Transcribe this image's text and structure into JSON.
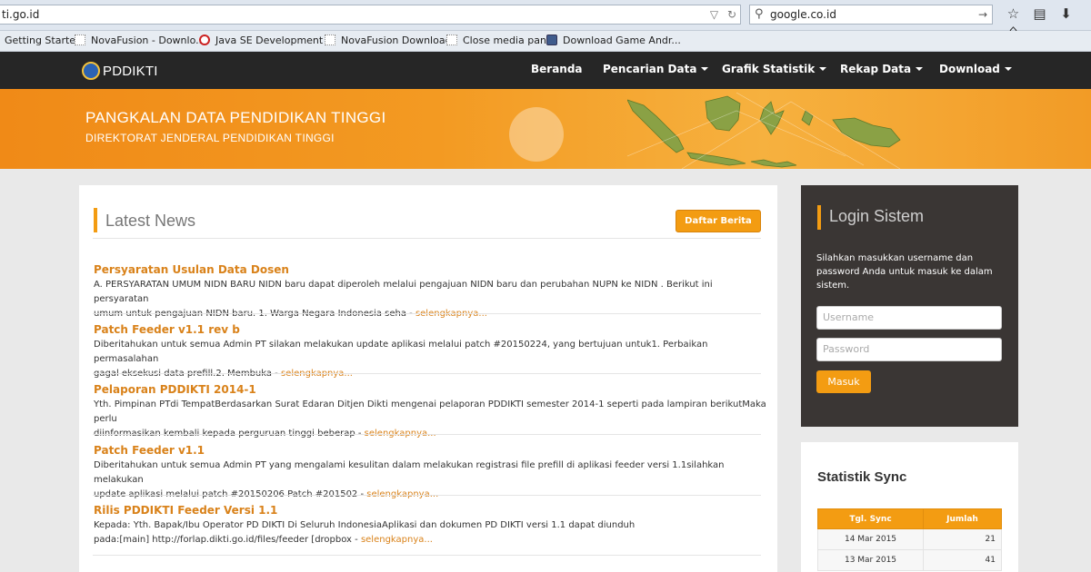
{
  "browser": {
    "url": "ti.go.id",
    "search_value": "google.co.id",
    "bookmarks": [
      {
        "label": "Getting Started"
      },
      {
        "label": "NovaFusion - Downlo..."
      },
      {
        "label": "Java SE Development ..."
      },
      {
        "label": "NovaFusion Downloads"
      },
      {
        "label": "Close media panel"
      },
      {
        "label": "Download Game Andr..."
      }
    ]
  },
  "site": {
    "logo": "PDDIKTI",
    "nav": [
      {
        "label": "Beranda",
        "dropdown": false
      },
      {
        "label": "Pencarian Data",
        "dropdown": true
      },
      {
        "label": "Grafik Statistik",
        "dropdown": true
      },
      {
        "label": "Rekap Data",
        "dropdown": true
      },
      {
        "label": "Download",
        "dropdown": true
      }
    ],
    "banner": {
      "title": "PANGKALAN DATA PENDIDIKAN TINGGI",
      "subtitle": "DIREKTORAT JENDERAL PENDIDIKAN TINGGI"
    }
  },
  "news": {
    "title": "Latest News",
    "daftar_label": "Daftar Berita",
    "read_more": "selengkapnya...",
    "items": [
      {
        "title": "Persyaratan Usulan Data Dosen",
        "line1": "A. PERSYARATAN UMUM NIDN BARU NIDN baru dapat diperoleh melalui pengajuan NIDN baru dan perubahan NUPN ke NIDN . Berikut ini persyaratan",
        "line2": "umum untuk pengajuan NIDN baru. 1. Warga Negara Indonesia seha - "
      },
      {
        "title": "Patch Feeder v1.1 rev b",
        "line1": "Diberitahukan untuk semua Admin PT  silakan melakukan update aplikasi melalui patch #20150224, yang bertujuan untuk1. Perbaikan permasalahan",
        "line2": "gagal eksekusi data prefill.2. Membuka - "
      },
      {
        "title": "Pelaporan PDDIKTI 2014-1",
        "line1": "Yth. Pimpinan PTdi TempatBerdasarkan Surat Edaran Ditjen Dikti mengenai pelaporan PDDIKTI semester 2014-1 seperti pada lampiran berikutMaka perlu",
        "line2": "diinformasikan kembali kepada perguruan tinggi beberap - "
      },
      {
        "title": "Patch Feeder v1.1",
        "line1": "Diberitahukan untuk semua Admin PT yang mengalami kesulitan dalam melakukan registrasi file prefill di aplikasi feeder versi 1.1silahkan melakukan",
        "line2": "update aplikasi melalui patch #20150206 Patch #201502 - "
      },
      {
        "title": "Rilis PDDIKTI Feeder Versi 1.1",
        "line1": "Kepada: Yth. Bapak/Ibu Operator PD DIKTI Di Seluruh IndonesiaAplikasi dan dokumen PD DIKTI  versi 1.1 dapat diunduh",
        "line2": "pada:[main] http://forlap.dikti.go.id/files/feeder [dropbox - "
      }
    ]
  },
  "login": {
    "title": "Login Sistem",
    "description": "Silahkan masukkan username dan password Anda untuk masuk ke dalam sistem.",
    "username_placeholder": "Username",
    "password_placeholder": "Password",
    "button_label": "Masuk"
  },
  "stats": {
    "title": "Statistik Sync",
    "headers": [
      "Tgl. Sync",
      "Jumlah"
    ],
    "rows": [
      {
        "date": "14 Mar 2015",
        "count": "21"
      },
      {
        "date": "13 Mar 2015",
        "count": "41"
      }
    ]
  },
  "colors": {
    "accent": "#f39c12",
    "navbar": "#262626",
    "login_bg": "#3a3634"
  }
}
